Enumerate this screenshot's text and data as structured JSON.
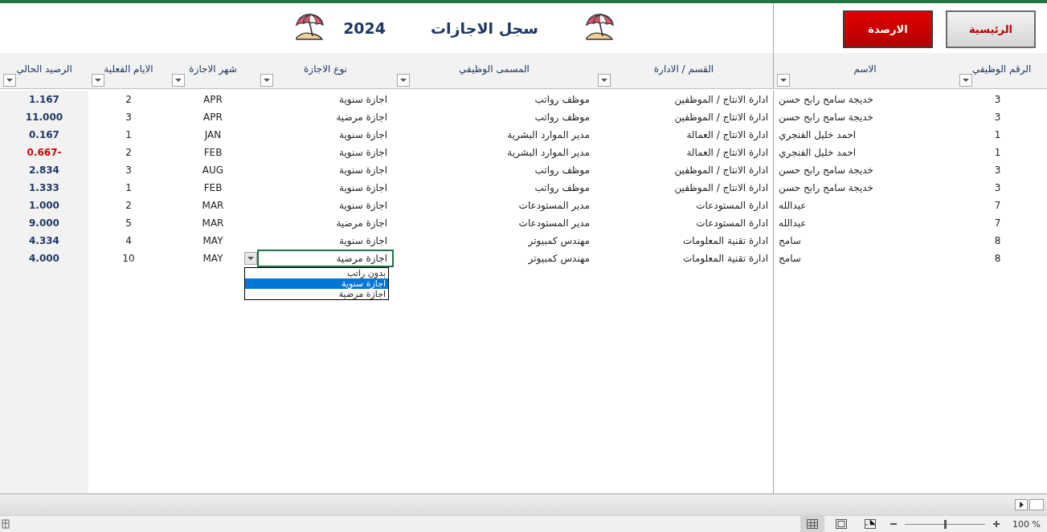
{
  "buttons": [
    {
      "label": "الرئيسية",
      "kind": "home"
    },
    {
      "label": "الارصدة",
      "kind": "balances"
    }
  ],
  "title": "سجل الاجازات",
  "year": "2024",
  "columns": [
    "الرقم الوظيفي",
    "الاسم",
    "القسم / الادارة",
    "المسمى الوظيفي",
    "نوع الاجازة",
    "شهر الاجازة",
    "الايام الفعلية",
    "الرصيد الحالي"
  ],
  "rows": [
    {
      "cells": [
        "3",
        "خديجة سامح رابح حسن",
        "ادارة الانتاج / الموظفين",
        "موظف رواتب",
        "اجازة سنوية",
        "APR",
        "2",
        "1.167"
      ],
      "color": "#1f3864",
      "editing": false
    },
    {
      "cells": [
        "3",
        "خديجة سامح رابح حسن",
        "ادارة الانتاج / الموظفين",
        "موظف رواتب",
        "اجازة مرضية",
        "APR",
        "3",
        "11.000"
      ],
      "color": "#1f3864",
      "editing": false
    },
    {
      "cells": [
        "1",
        "احمد خليل الفنجري",
        "ادارة الانتاج / العمالة",
        "مدير الموارد البشرية",
        "اجازة سنوية",
        "JAN",
        "1",
        "0.167"
      ],
      "color": "#1f3864",
      "editing": false
    },
    {
      "cells": [
        "1",
        "احمد خليل الفنجري",
        "ادارة الانتاج / العمالة",
        "مدير الموارد البشرية",
        "اجازة سنوية",
        "FEB",
        "2",
        "-0.667"
      ],
      "color": "#d00000",
      "editing": false
    },
    {
      "cells": [
        "3",
        "خديجة سامح رابح حسن",
        "ادارة الانتاج / الموظفين",
        "موظف رواتب",
        "اجازة سنوية",
        "AUG",
        "3",
        "2.834"
      ],
      "color": "#1f3864",
      "editing": false
    },
    {
      "cells": [
        "3",
        "خديجة سامح رابح حسن",
        "ادارة الانتاج / الموظفين",
        "موظف رواتب",
        "اجازة سنوية",
        "FEB",
        "1",
        "1.333"
      ],
      "color": "#1f3864",
      "editing": false
    },
    {
      "cells": [
        "7",
        "عبدالله",
        "ادارة المستودعات",
        "مدير المستودعات",
        "اجازة سنوية",
        "MAR",
        "2",
        "1.000"
      ],
      "color": "#1f3864",
      "editing": false
    },
    {
      "cells": [
        "7",
        "عبدالله",
        "ادارة المستودعات",
        "مدير المستودعات",
        "اجازة مرضية",
        "MAR",
        "5",
        "9.000"
      ],
      "color": "#1f3864",
      "editing": false
    },
    {
      "cells": [
        "8",
        "سامح",
        "ادارة تقنية المعلومات",
        "مهندس كمبيوتر",
        "اجازة سنوية",
        "MAY",
        "4",
        "4.334"
      ],
      "color": "#1f3864",
      "editing": false
    },
    {
      "cells": [
        "8",
        "سامح",
        "ادارة تقنية المعلومات",
        "مهندس كمبيوتر",
        "اجازة مرضية",
        "MAY",
        "10",
        "4.000"
      ],
      "color": "#1f3864",
      "editing": true
    }
  ],
  "dropdown": {
    "options": [
      {
        "label": "بدون راتب",
        "selected": false
      },
      {
        "label": "اجازة سنوية",
        "selected": true
      },
      {
        "label": "اجازة مرضية",
        "selected": false
      }
    ]
  },
  "status_bar": {
    "views": [
      {
        "kind": "normal",
        "selected": true
      },
      {
        "kind": "layout",
        "selected": false
      },
      {
        "kind": "pagebreak",
        "selected": false
      }
    ],
    "zoom": {
      "level": 0.5,
      "reading": "100 %"
    }
  }
}
